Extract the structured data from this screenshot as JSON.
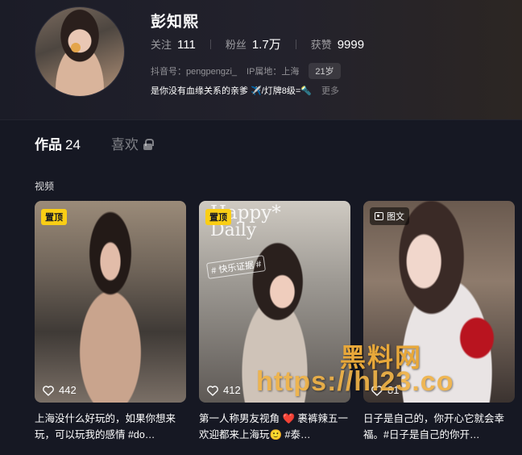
{
  "profile": {
    "name": "彭知熙",
    "stats": [
      {
        "label": "关注",
        "value": "111"
      },
      {
        "label": "粉丝",
        "value": "1.7万"
      },
      {
        "label": "获赞",
        "value": "9999"
      }
    ],
    "douyin_id": "抖音号：pengpengzi_",
    "ip_location": "IP属地：上海",
    "age": "21岁",
    "bio": "是你没有血缘关系的亲爹 ✈️/灯牌8级=🔦",
    "more": "更多"
  },
  "tabs": {
    "works_label": "作品",
    "works_count": "24",
    "likes_label": "喜欢"
  },
  "section": {
    "label": "视频"
  },
  "cards": [
    {
      "badge": "置顶",
      "likes": "442",
      "desc": "上海没什么好玩的，如果你想来玩，可以玩我的感情 #do…",
      "icon": "heart-icon"
    },
    {
      "badge": "置顶",
      "overlay_title": "Happy*",
      "overlay_sub": "Daily",
      "overlay_tag": "# 快乐证据 #",
      "likes": "412",
      "desc": "第一人称男友视角 ❤️ 裹裤辣五一欢迎都来上海玩🙂 #泰…",
      "icon": "heart-icon"
    },
    {
      "badge": "图文",
      "likes": "81",
      "desc": "日子是自己的，你开心它就会幸福。#日子是自己的你开…",
      "icon": "heart-icon"
    }
  ],
  "watermark": {
    "line1": "黑料网",
    "line2": "https://hl23.co"
  },
  "colors": {
    "background": "#161823",
    "pin_badge": "#face15",
    "watermark": "#e8a83a"
  }
}
